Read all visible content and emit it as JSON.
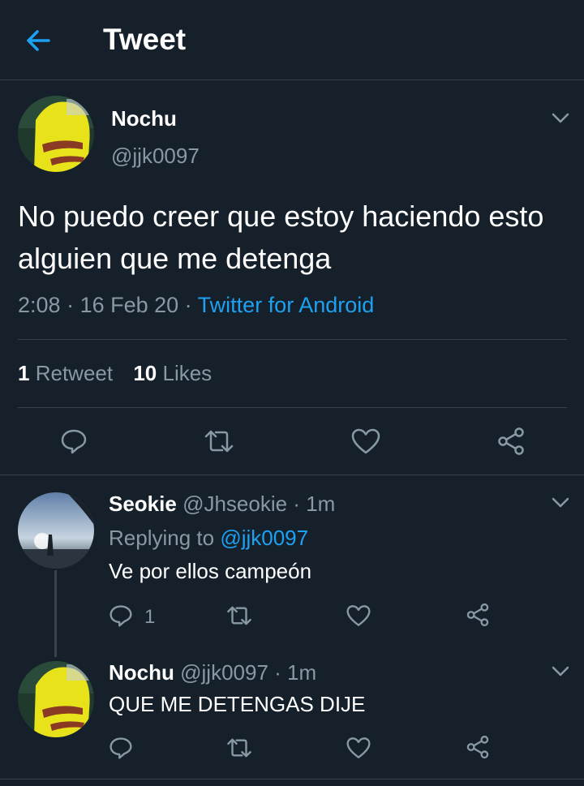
{
  "header": {
    "title": "Tweet",
    "back_icon": "back-arrow-icon"
  },
  "colors": {
    "background": "#15202b",
    "accent": "#1da1f2",
    "muted": "#8899a6",
    "divider": "#38444d"
  },
  "tweet": {
    "name": "Nochu",
    "handle": "@jjk0097",
    "text": "No puedo creer que estoy haciendo esto alguien que me detenga",
    "time": "2:08",
    "date": "16 Feb 20",
    "source": "Twitter for Android",
    "retweets_count": "1",
    "retweets_label": "Retweet",
    "likes_count": "10",
    "likes_label": "Likes"
  },
  "replies": [
    {
      "name": "Seokie",
      "handle": "@Jhseokie",
      "time": "1m",
      "replying_label": "Replying to",
      "replying_to": "@jjk0097",
      "text": "Ve por ellos campeón",
      "reply_count": "1"
    },
    {
      "name": "Nochu",
      "handle": "@jjk0097",
      "time": "1m",
      "text": "QUE ME DETENGAS DIJE"
    }
  ],
  "separators": {
    "dot": " · "
  }
}
